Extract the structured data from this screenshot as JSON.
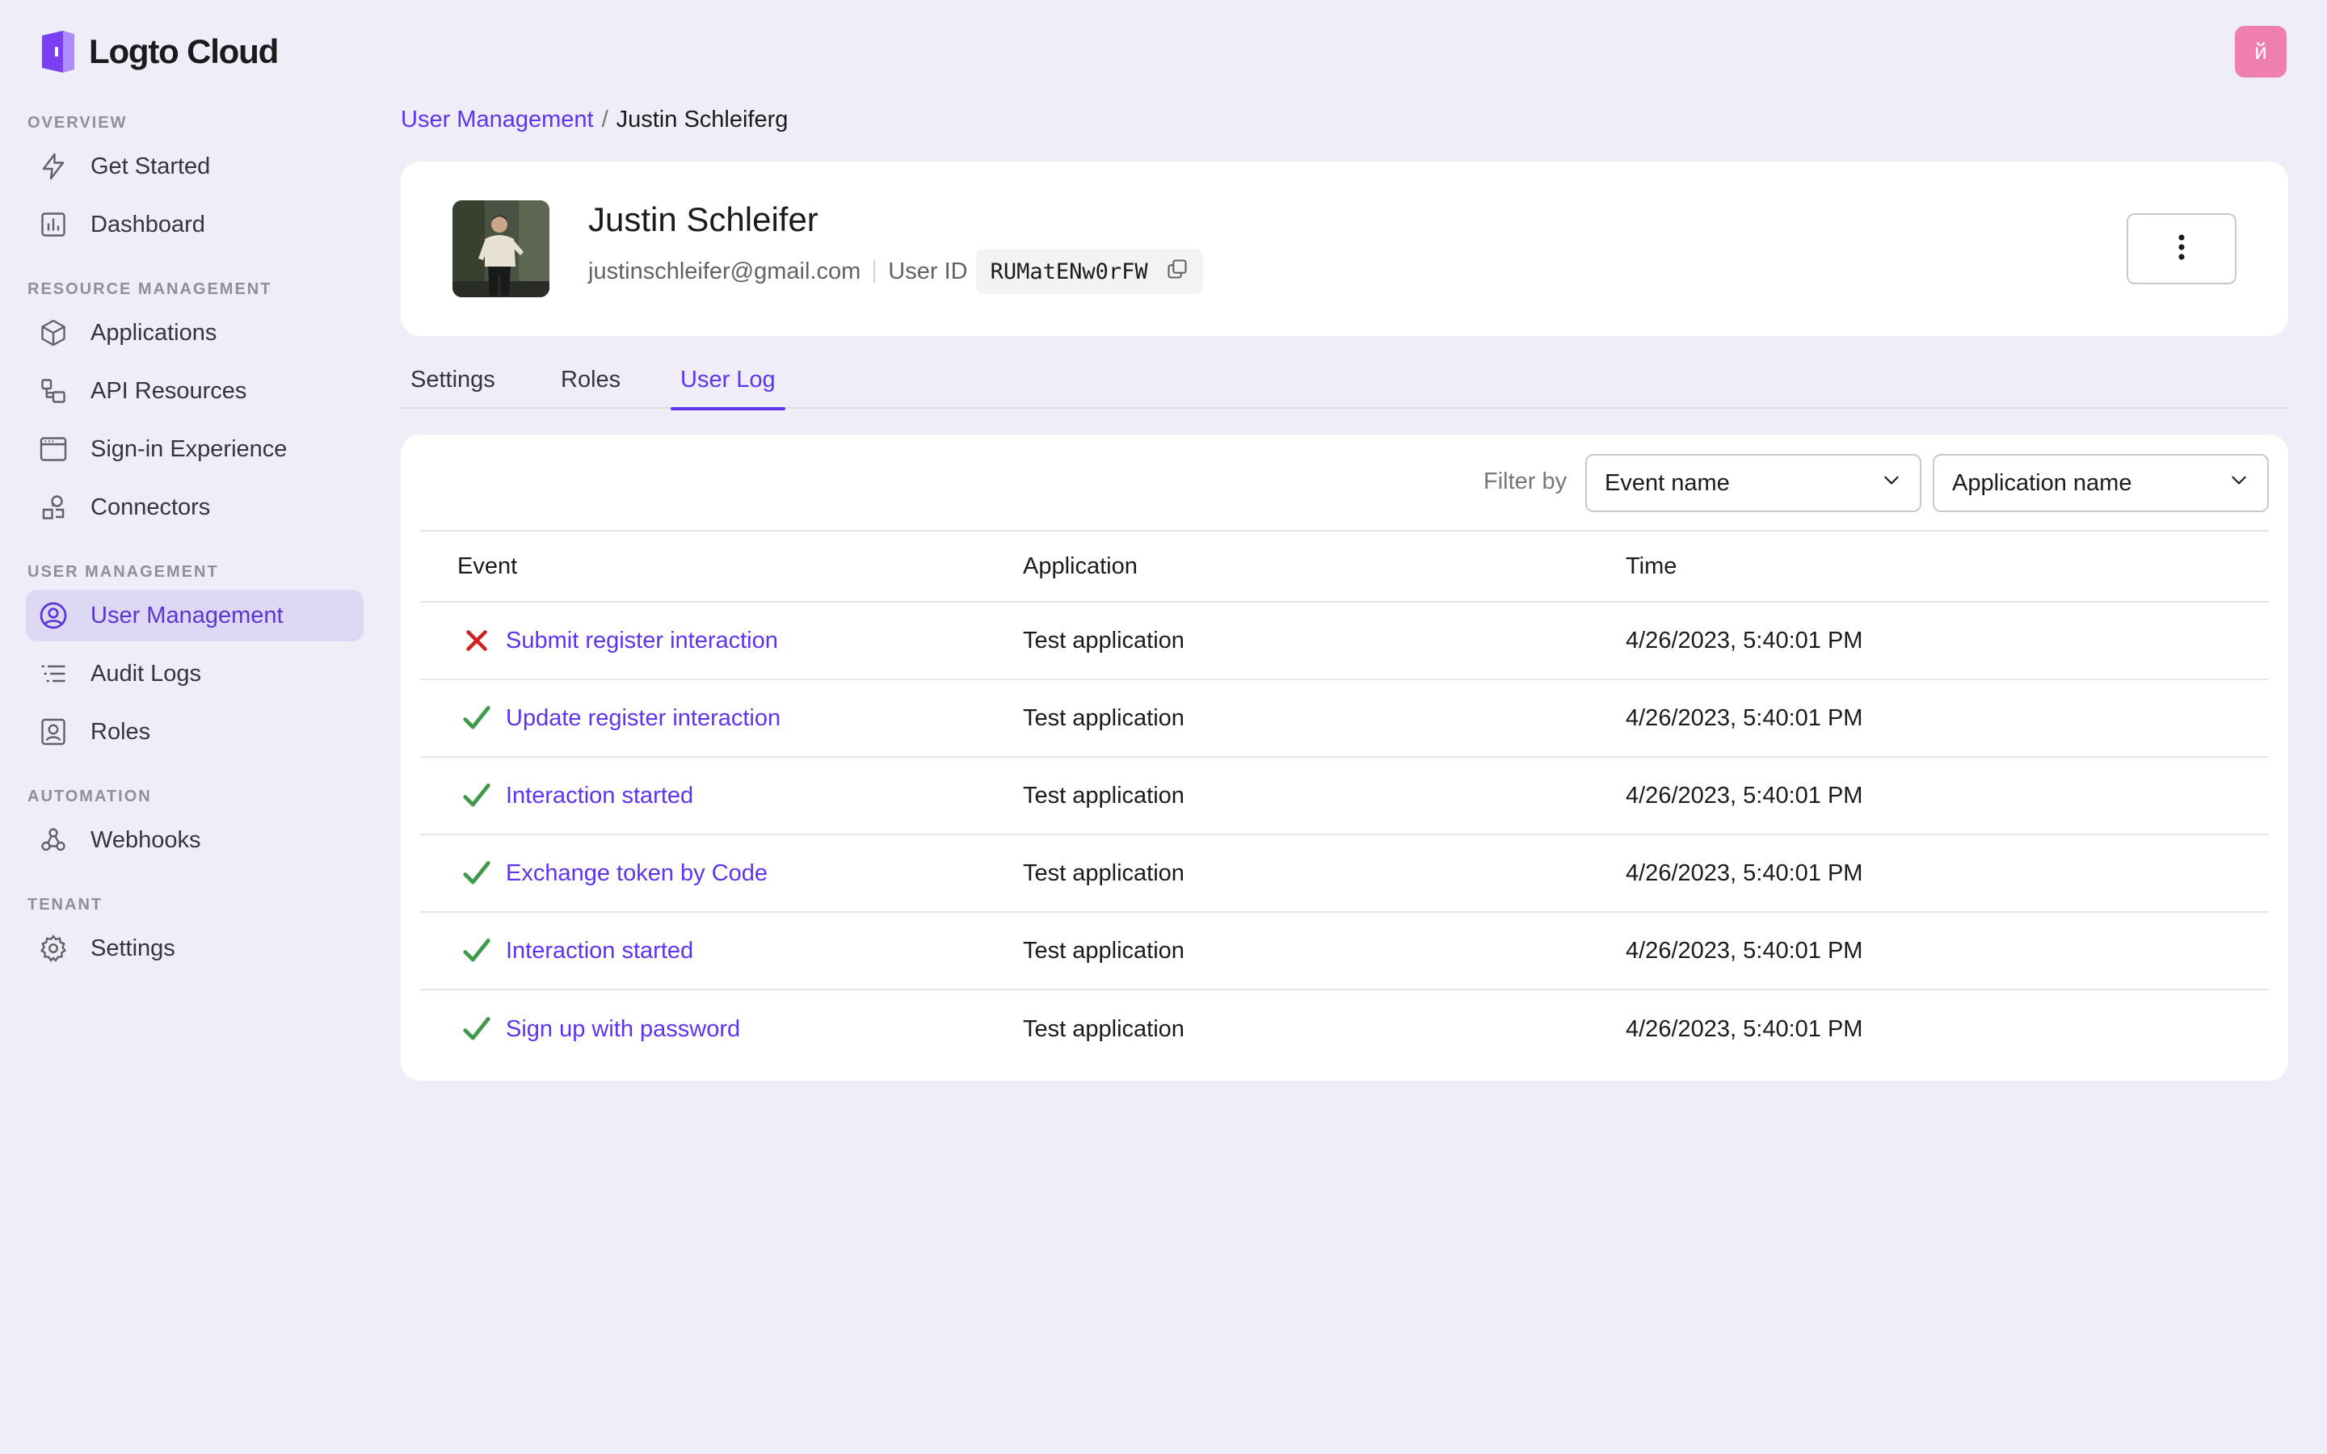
{
  "brand": {
    "name": "Logto Cloud",
    "accent": "#5d34f2"
  },
  "top_avatar": {
    "initial": "й",
    "color": "#ef7fb0"
  },
  "sidebar": {
    "groups": [
      {
        "title": "OVERVIEW",
        "items": [
          {
            "label": "Get Started",
            "icon": "bolt-icon"
          },
          {
            "label": "Dashboard",
            "icon": "chart-icon"
          }
        ]
      },
      {
        "title": "RESOURCE MANAGEMENT",
        "items": [
          {
            "label": "Applications",
            "icon": "cube-icon"
          },
          {
            "label": "API Resources",
            "icon": "api-icon"
          },
          {
            "label": "Sign-in Experience",
            "icon": "browser-icon"
          },
          {
            "label": "Connectors",
            "icon": "connector-icon"
          }
        ]
      },
      {
        "title": "USER MANAGEMENT",
        "items": [
          {
            "label": "User Management",
            "icon": "user-circle-icon",
            "active": true
          },
          {
            "label": "Audit Logs",
            "icon": "list-icon"
          },
          {
            "label": "Roles",
            "icon": "role-icon"
          }
        ]
      },
      {
        "title": "AUTOMATION",
        "items": [
          {
            "label": "Webhooks",
            "icon": "webhook-icon"
          }
        ]
      },
      {
        "title": "TENANT",
        "items": [
          {
            "label": "Settings",
            "icon": "gear-icon"
          }
        ]
      }
    ]
  },
  "breadcrumb": {
    "parent": "User Management",
    "separator": "/",
    "current": "Justin Schleiferg"
  },
  "user": {
    "name": "Justin Schleifer",
    "email": "justinschleifer@gmail.com",
    "user_id_label": "User ID",
    "user_id": "RUMatENw0rFW"
  },
  "tabs": [
    {
      "label": "Settings",
      "active": false
    },
    {
      "label": "Roles",
      "active": false
    },
    {
      "label": "User Log",
      "active": true
    }
  ],
  "filters": {
    "label": "Filter by",
    "event_select": "Event name",
    "application_select": "Application name"
  },
  "table": {
    "columns": [
      "Event",
      "Application",
      "Time"
    ],
    "rows": [
      {
        "status": "failure",
        "event": "Submit register interaction",
        "application": "Test application",
        "time": "4/26/2023, 5:40:01 PM"
      },
      {
        "status": "success",
        "event": "Update register interaction",
        "application": "Test application",
        "time": "4/26/2023, 5:40:01 PM"
      },
      {
        "status": "success",
        "event": "Interaction started",
        "application": "Test application",
        "time": "4/26/2023, 5:40:01 PM"
      },
      {
        "status": "success",
        "event": "Exchange token by Code",
        "application": "Test application",
        "time": "4/26/2023, 5:40:01 PM"
      },
      {
        "status": "success",
        "event": "Interaction started",
        "application": "Test application",
        "time": "4/26/2023, 5:40:01 PM"
      },
      {
        "status": "success",
        "event": "Sign up with password",
        "application": "Test application",
        "time": "4/26/2023, 5:40:01 PM"
      }
    ],
    "status_colors": {
      "success": "#3e9a4a",
      "failure": "#d0211c"
    }
  }
}
